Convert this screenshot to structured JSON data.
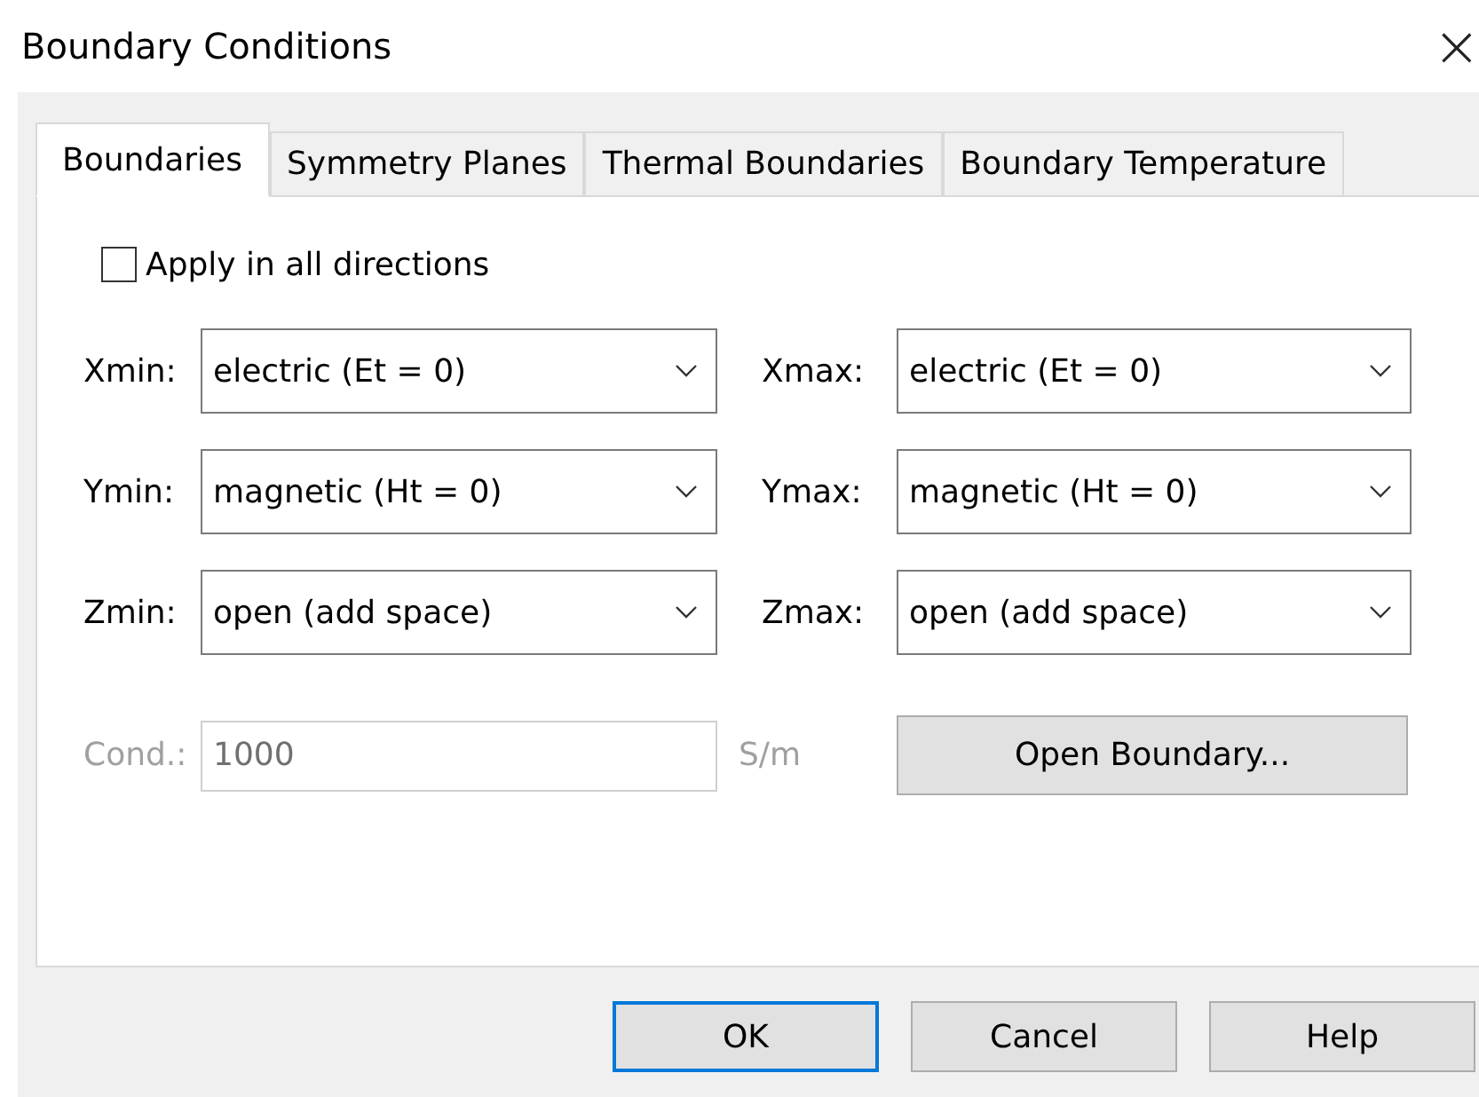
{
  "window": {
    "title": "Boundary Conditions",
    "close": "×"
  },
  "tabs": [
    {
      "label": "Boundaries",
      "selected": true
    },
    {
      "label": "Symmetry Planes",
      "selected": false
    },
    {
      "label": "Thermal Boundaries",
      "selected": false
    },
    {
      "label": "Boundary Temperature",
      "selected": false
    }
  ],
  "apply_all": {
    "label": "Apply in all directions",
    "checked": false
  },
  "boundaries": [
    {
      "label": "Xmin:",
      "value": "electric (Et = 0)"
    },
    {
      "label": "Xmax:",
      "value": "electric (Et = 0)"
    },
    {
      "label": "Ymin:",
      "value": "magnetic (Ht = 0)"
    },
    {
      "label": "Ymax:",
      "value": "magnetic (Ht = 0)"
    },
    {
      "label": "Zmin:",
      "value": "open (add space)"
    },
    {
      "label": "Zmax:",
      "value": "open (add space)"
    }
  ],
  "conductivity": {
    "label": "Cond.:",
    "value": "1000",
    "unit": "S/m",
    "disabled": true
  },
  "open_boundary_button": "Open Boundary...",
  "buttons": [
    {
      "label": "OK",
      "default": true
    },
    {
      "label": "Cancel",
      "default": false
    },
    {
      "label": "Help",
      "default": false
    }
  ]
}
